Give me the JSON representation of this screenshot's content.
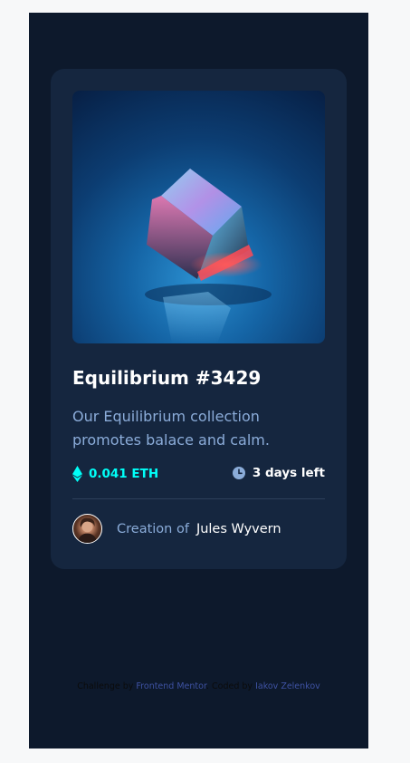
{
  "card": {
    "image_alt": "Equilibrium",
    "title": "Equilibrium #3429",
    "description": "Our Equilibrium collection promotes balace and calm.",
    "price": "0.041 ETH",
    "time_left": "3 days left",
    "creation_label": "Creation of",
    "creator_name": "Jules Wyvern"
  },
  "footer": {
    "challenge_prefix": "Challenge by",
    "challenge_link": "Frontend Mentor",
    "coded_prefix": ". Coded by",
    "coded_link": "Iakov Zelenkov"
  },
  "colors": {
    "page_bg": "#0d192c",
    "card_bg": "#15263f",
    "accent_cyan": "#00fff8",
    "soft_blue": "#8bacd9",
    "white": "#ffffff",
    "link_blue": "#3e52a3"
  },
  "icons": {
    "price": "ethereum-icon",
    "time": "clock-icon"
  }
}
